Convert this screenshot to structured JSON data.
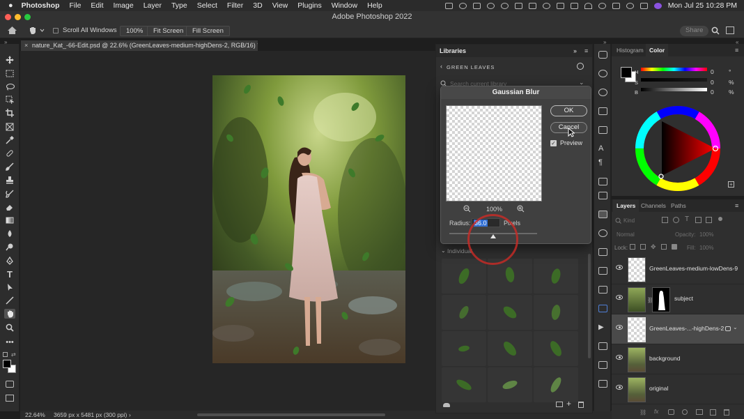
{
  "menubar": {
    "apple": "",
    "items": [
      "Photoshop",
      "File",
      "Edit",
      "Image",
      "Layer",
      "Type",
      "Select",
      "Filter",
      "3D",
      "View",
      "Plugins",
      "Window",
      "Help"
    ],
    "datetime": "Mon Jul 25  10:28 PM"
  },
  "window": {
    "title": "Adobe Photoshop 2022"
  },
  "options": {
    "scroll_all_windows": "Scroll All Windows",
    "zoom_btn": "100%",
    "fit_screen": "Fit Screen",
    "fill_screen": "Fill Screen",
    "share": "Share"
  },
  "document": {
    "tab_title": "nature_Kat_-66-Edit.psd @ 22.6% (GreenLeaves-medium-highDens-2, RGB/16) *",
    "status_zoom": "22.64%",
    "status_info": "3659 px x 5481 px (300 ppi)"
  },
  "libraries": {
    "panel_title": "Libraries",
    "library_name": "GREEN LEAVES",
    "search_placeholder": "Search current library",
    "group_label": "Individual"
  },
  "gaussian_blur": {
    "title": "Gaussian Blur",
    "ok": "OK",
    "cancel": "Cancel",
    "preview_label": "Preview",
    "preview_checked": true,
    "zoom": "100%",
    "radius_label": "Radius:",
    "radius_value": "36.0",
    "radius_unit": "Pixels"
  },
  "color_panel": {
    "tabs": [
      "Histogram",
      "Color"
    ],
    "active_tab": "Color",
    "sliders": [
      {
        "label": "H",
        "value": "0",
        "unit": "°"
      },
      {
        "label": "S",
        "value": "0",
        "unit": "%"
      },
      {
        "label": "B",
        "value": "0",
        "unit": "%"
      }
    ]
  },
  "layers_panel": {
    "tabs": [
      "Layers",
      "Channels",
      "Paths"
    ],
    "active_tab": "Layers",
    "kind_placeholder": "Kind",
    "blend_mode": "Normal",
    "opacity_label": "Opacity:",
    "opacity_value": "100%",
    "lock_label": "Lock:",
    "fill_label": "Fill:",
    "fill_value": "100%",
    "layers": [
      {
        "name": "GreenLeaves-medium-lowDens-9",
        "selected": false
      },
      {
        "name": "subject",
        "selected": false
      },
      {
        "name": "GreenLeaves-...-highDens-2",
        "selected": true
      },
      {
        "name": "background",
        "selected": false
      },
      {
        "name": "original",
        "selected": false
      }
    ]
  },
  "colors": {
    "accent_red": "#e0322b",
    "selection_blue": "#2f6ed3",
    "panel_bg": "#2f2f2f"
  }
}
